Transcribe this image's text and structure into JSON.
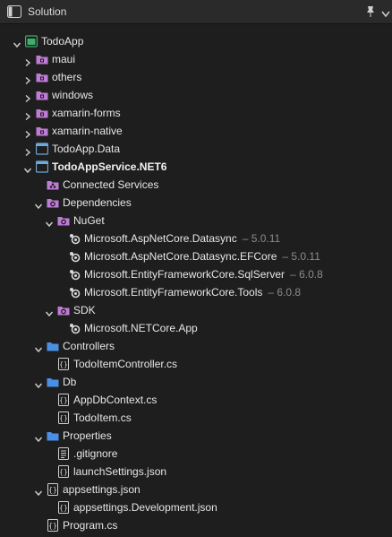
{
  "header": {
    "title": "Solution",
    "icons": [
      "sidebar-toggle-icon",
      "pin-icon",
      "chevron-down-icon"
    ]
  },
  "tree": [
    {
      "label": "TodoApp",
      "icon": "solution-icon",
      "chevron": "down",
      "level": 0
    },
    {
      "label": "maui",
      "icon": "solution-folder-icon",
      "chevron": "right",
      "level": 1
    },
    {
      "label": "others",
      "icon": "solution-folder-icon",
      "chevron": "right",
      "level": 1
    },
    {
      "label": "windows",
      "icon": "solution-folder-icon",
      "chevron": "right",
      "level": 1
    },
    {
      "label": "xamarin-forms",
      "icon": "solution-folder-icon",
      "chevron": "right",
      "level": 1
    },
    {
      "label": "xamarin-native",
      "icon": "solution-folder-icon",
      "chevron": "right",
      "level": 1
    },
    {
      "label": "TodoApp.Data",
      "icon": "project-icon",
      "chevron": "right",
      "level": 1
    },
    {
      "label": "TodoAppService.NET6",
      "icon": "project-icon",
      "chevron": "down",
      "level": 1,
      "bold": true
    },
    {
      "label": "Connected Services",
      "icon": "connected-services-icon",
      "chevron": "",
      "level": 2
    },
    {
      "label": "Dependencies",
      "icon": "dependencies-folder-icon",
      "chevron": "down",
      "level": 2
    },
    {
      "label": "NuGet",
      "icon": "dependencies-folder-icon",
      "chevron": "down",
      "level": 3
    },
    {
      "label": "Microsoft.AspNetCore.Datasync",
      "version": "– 5.0.11",
      "icon": "package-icon",
      "chevron": "",
      "level": 4
    },
    {
      "label": "Microsoft.AspNetCore.Datasync.EFCore",
      "version": "– 5.0.11",
      "icon": "package-icon",
      "chevron": "",
      "level": 4
    },
    {
      "label": "Microsoft.EntityFrameworkCore.SqlServer",
      "version": "– 6.0.8",
      "icon": "package-icon",
      "chevron": "",
      "level": 4
    },
    {
      "label": "Microsoft.EntityFrameworkCore.Tools",
      "version": "– 6.0.8",
      "icon": "package-icon",
      "chevron": "",
      "level": 4
    },
    {
      "label": "SDK",
      "icon": "dependencies-folder-icon",
      "chevron": "down",
      "level": 3
    },
    {
      "label": "Microsoft.NETCore.App",
      "icon": "package-icon",
      "chevron": "",
      "level": 4
    },
    {
      "label": "Controllers",
      "icon": "folder-icon",
      "chevron": "down",
      "level": 2
    },
    {
      "label": "TodoItemController.cs",
      "icon": "code-file-icon",
      "chevron": "",
      "level": 3
    },
    {
      "label": "Db",
      "icon": "folder-icon",
      "chevron": "down",
      "level": 2
    },
    {
      "label": "AppDbContext.cs",
      "icon": "code-file-icon",
      "chevron": "",
      "level": 3
    },
    {
      "label": "TodoItem.cs",
      "icon": "code-file-icon",
      "chevron": "",
      "level": 3
    },
    {
      "label": "Properties",
      "icon": "folder-icon",
      "chevron": "down",
      "level": 2
    },
    {
      "label": ".gitignore",
      "icon": "text-file-icon",
      "chevron": "",
      "level": 3
    },
    {
      "label": "launchSettings.json",
      "icon": "code-file-icon",
      "chevron": "",
      "level": 3
    },
    {
      "label": "appsettings.json",
      "icon": "code-file-icon",
      "chevron": "down",
      "level": 2
    },
    {
      "label": "appsettings.Development.json",
      "icon": "code-file-icon",
      "chevron": "",
      "level": 3
    },
    {
      "label": "Program.cs",
      "icon": "code-file-icon",
      "chevron": "",
      "level": 2
    }
  ],
  "colors": {
    "background": "#1e1e1e",
    "solution_folder": "#c07bd6",
    "folder": "#4a90e2",
    "project": "#6fa8dc",
    "solution": "#3fae6b",
    "text": "#e6e6e6",
    "version": "#8c8c8c"
  }
}
